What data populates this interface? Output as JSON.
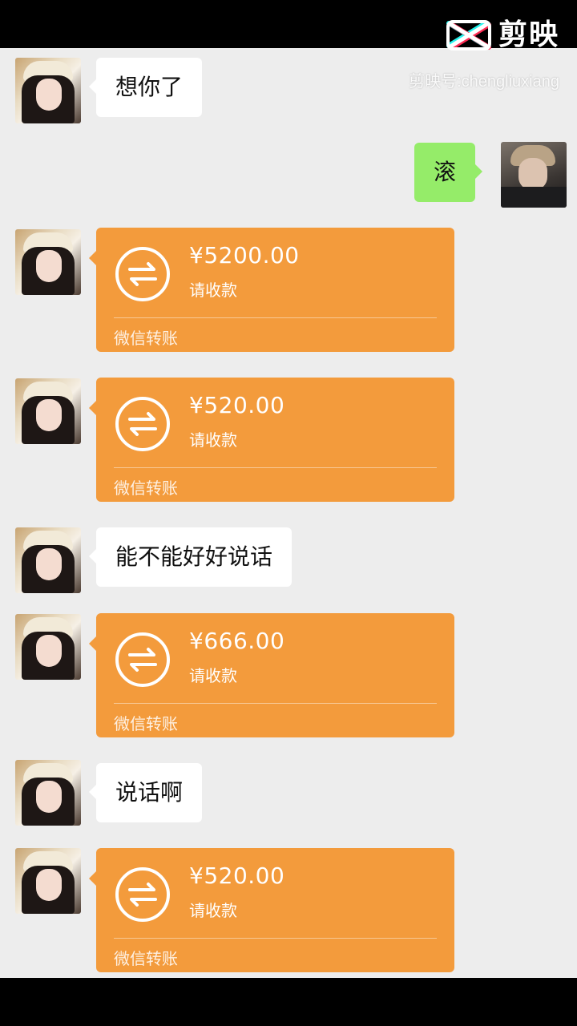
{
  "app": {
    "logo_text": "剪映",
    "watermark": "剪映号:chengliuxiang"
  },
  "colors": {
    "transfer_bg": "#f39b3c",
    "sent_bubble": "#95ec69",
    "chat_bg": "#ededed"
  },
  "messages": {
    "m1": {
      "text": "想你了"
    },
    "m2": {
      "text": "滚"
    },
    "t1": {
      "amount": "¥5200.00",
      "status": "请收款",
      "label": "微信转账"
    },
    "t2": {
      "amount": "¥520.00",
      "status": "请收款",
      "label": "微信转账"
    },
    "m3": {
      "text": "能不能好好说话"
    },
    "t3": {
      "amount": "¥666.00",
      "status": "请收款",
      "label": "微信转账"
    },
    "m4": {
      "text": "说话啊"
    },
    "t4": {
      "amount": "¥520.00",
      "status": "请收款",
      "label": "微信转账"
    }
  }
}
